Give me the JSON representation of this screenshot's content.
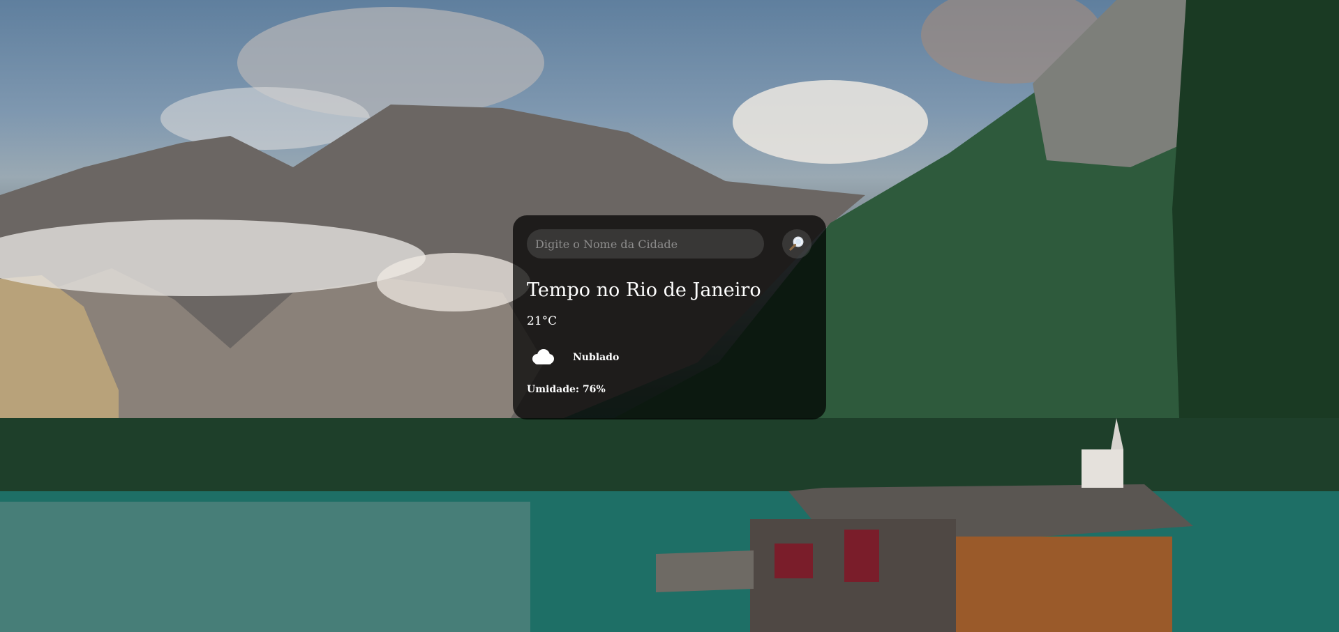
{
  "search": {
    "placeholder": "Digite o Nome da Cidade",
    "value": "",
    "button_icon": "search-icon"
  },
  "weather": {
    "title": "Tempo no Rio de Janeiro",
    "temperature": "21°C",
    "condition_icon": "cloud-icon",
    "condition": "Nublado",
    "humidity": "Umidade: 76%"
  },
  "colors": {
    "card_background": "#000000b8",
    "text": "#ffffff",
    "input_background": "#7c7c7c47"
  }
}
